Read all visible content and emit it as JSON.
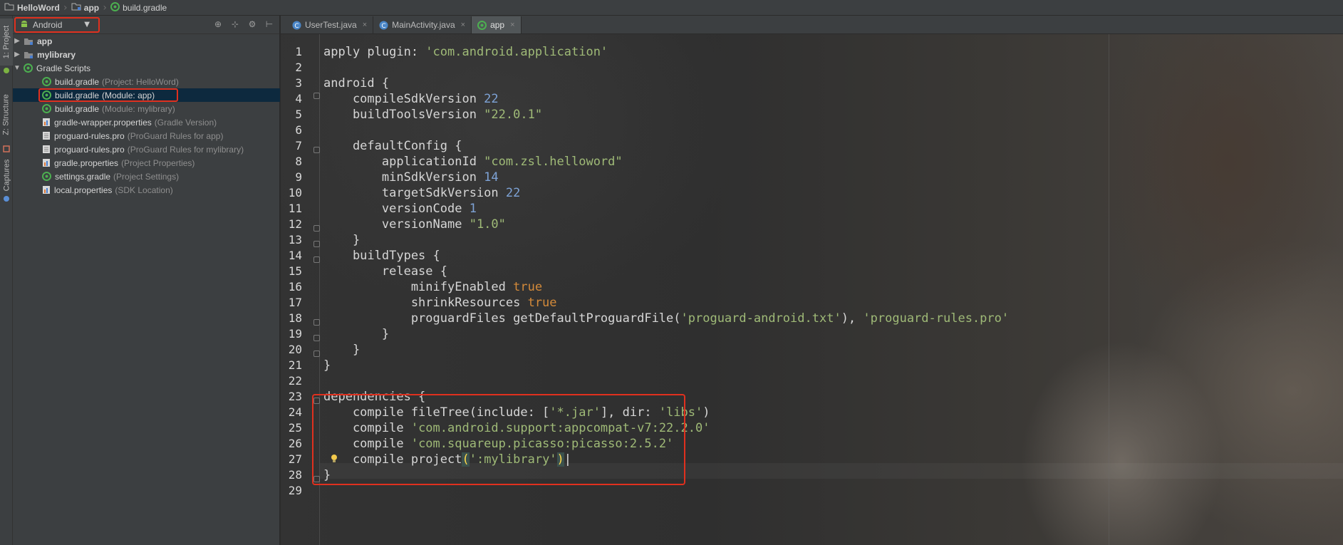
{
  "breadcrumb": {
    "items": [
      "HelloWord",
      "app",
      "build.gradle"
    ]
  },
  "toolwindow_tabs": [
    "1: Project",
    "Z: Structure",
    "Captures"
  ],
  "project_panel": {
    "view_mode": "Android",
    "tree": [
      {
        "name": "app",
        "hint": "",
        "type": "module",
        "arrow": "▶"
      },
      {
        "name": "mylibrary",
        "hint": "",
        "type": "module",
        "arrow": "▶"
      },
      {
        "name": "Gradle Scripts",
        "hint": "",
        "type": "gradle-group",
        "arrow": "▼"
      },
      {
        "name": "build.gradle",
        "hint": "(Project: HelloWord)",
        "type": "gradle"
      },
      {
        "name": "build.gradle",
        "hint": "(Module: app)",
        "type": "gradle"
      },
      {
        "name": "build.gradle",
        "hint": "(Module: mylibrary)",
        "type": "gradle"
      },
      {
        "name": "gradle-wrapper.properties",
        "hint": "(Gradle Version)",
        "type": "props"
      },
      {
        "name": "proguard-rules.pro",
        "hint": "(ProGuard Rules for app)",
        "type": "file"
      },
      {
        "name": "proguard-rules.pro",
        "hint": "(ProGuard Rules for mylibrary)",
        "type": "file"
      },
      {
        "name": "gradle.properties",
        "hint": "(Project Properties)",
        "type": "props"
      },
      {
        "name": "settings.gradle",
        "hint": "(Project Settings)",
        "type": "gradle"
      },
      {
        "name": "local.properties",
        "hint": "(SDK Location)",
        "type": "props"
      }
    ]
  },
  "editor_tabs": [
    {
      "label": "UserTest.java",
      "icon": "class-icon",
      "active": false
    },
    {
      "label": "MainActivity.java",
      "icon": "class-icon",
      "active": false
    },
    {
      "label": "app",
      "icon": "gradle-icon",
      "active": true
    }
  ],
  "code": {
    "line_numbers": [
      "1",
      "2",
      "3",
      "4",
      "5",
      "6",
      "7",
      "8",
      "9",
      "10",
      "11",
      "12",
      "13",
      "14",
      "15",
      "16",
      "17",
      "18",
      "19",
      "20",
      "21",
      "22",
      "23",
      "24",
      "25",
      "26",
      "27",
      "28",
      "29"
    ],
    "lines": {
      "l1_a": "apply plugin: ",
      "l1_b": "'com.android.application'",
      "l3": "android {",
      "l4_a": "    compileSdkVersion ",
      "l4_b": "22",
      "l5_a": "    buildToolsVersion ",
      "l5_b": "\"22.0.1\"",
      "l7": "    defaultConfig {",
      "l8_a": "        applicationId ",
      "l8_b": "\"com.zsl.helloword\"",
      "l9_a": "        minSdkVersion ",
      "l9_b": "14",
      "l10_a": "        targetSdkVersion ",
      "l10_b": "22",
      "l11_a": "        versionCode ",
      "l11_b": "1",
      "l12_a": "        versionName ",
      "l12_b": "\"1.0\"",
      "l13": "    }",
      "l14": "    buildTypes {",
      "l15": "        release {",
      "l16_a": "            minifyEnabled ",
      "l16_b": "true",
      "l17_a": "            shrinkResources ",
      "l17_b": "true",
      "l18_a": "            proguardFiles getDefaultProguardFile(",
      "l18_b": "'proguard-android.txt'",
      "l18_c": "), ",
      "l18_d": "'proguard-rules.pro'",
      "l19": "        }",
      "l20": "    }",
      "l21": "}",
      "l23": "dependencies {",
      "l24_a": "    compile fileTree(include: [",
      "l24_b": "'*.jar'",
      "l24_c": "], dir: ",
      "l24_d": "'libs'",
      "l24_e": ")",
      "l25_a": "    compile ",
      "l25_b": "'com.android.support:appcompat-v7:22.2.0'",
      "l26_a": "    compile ",
      "l26_b": "'com.squareup.picasso:picasso:2.5.2'",
      "l27_a": "    compile project",
      "l27_b": "(",
      "l27_c": "':mylibrary'",
      "l27_d": ")",
      "l28": "}"
    }
  },
  "colors": {
    "highlight_box": "#e0301e",
    "string": "#9fba77",
    "number": "#7ea3d6",
    "keyword": "#d48a3a"
  }
}
